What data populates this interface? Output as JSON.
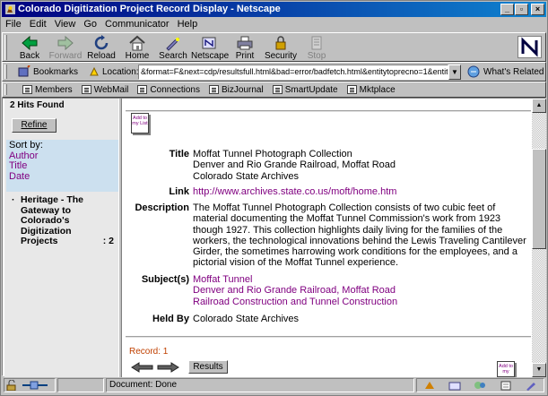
{
  "window": {
    "title": "Colorado Digitization Project Record Display - Netscape"
  },
  "menu": [
    "File",
    "Edit",
    "View",
    "Go",
    "Communicator",
    "Help"
  ],
  "toolbar": {
    "back": "Back",
    "forward": "Forward",
    "reload": "Reload",
    "home": "Home",
    "search": "Search",
    "netscape": "Netscape",
    "print": "Print",
    "security": "Security",
    "stop": "Stop"
  },
  "location": {
    "bookmarks": "Bookmarks",
    "label": "Location:",
    "url": "&format=F&next=cdp/resultsfull.html&bad=error/badfetch.html&entitytoprecno=1&entitycurrecno=1",
    "related": "What's Related"
  },
  "personal": [
    "Members",
    "WebMail",
    "Connections",
    "BizJournal",
    "SmartUpdate",
    "Mktplace"
  ],
  "sidebar": {
    "hits": "2 Hits Found",
    "refine": "Refine",
    "sort_label": "Sort by:",
    "sort_options": [
      "Author",
      "Title",
      "Date"
    ],
    "heritage": "Heritage - The Gateway to Colorado's Digitization Projects",
    "heritage_count": ": 2"
  },
  "record": {
    "add_label": "Add to my List",
    "title_key": "Title",
    "title_lines": [
      "Moffat Tunnel Photograph Collection",
      "Denver and Rio Grande Railroad, Moffat Road",
      "Colorado State Archives"
    ],
    "link_key": "Link",
    "link": "http://www.archives.state.co.us/moft/home.htm",
    "desc_key": "Description",
    "description": "The Moffat Tunnel Photograph Collection consists of two cubic feet of material documenting the Moffat Tunnel Commission's work from 1923 though 1927. This collection highlights daily living for the families of the workers, the technological innovations behind the Lewis Traveling Cantilever Girder, the sometimes harrowing work conditions for the employees, and a pictorial vision of the Moffat Tunnel experience.",
    "subj_key": "Subject(s)",
    "subjects": [
      "Moffat Tunnel",
      "Denver and Rio Grande Railroad, Moffat Road",
      "Railroad Construction and Tunnel Construction"
    ],
    "heldby_key": "Held By",
    "heldby": "Colorado State Archives",
    "record_num": "Record: 1",
    "results": "Results",
    "add_short": "Add to my"
  },
  "status": {
    "text": "Document: Done"
  },
  "colors": {
    "titlebar": "#000080",
    "visited_link": "#800080",
    "sort_bg": "#cce0ef"
  }
}
